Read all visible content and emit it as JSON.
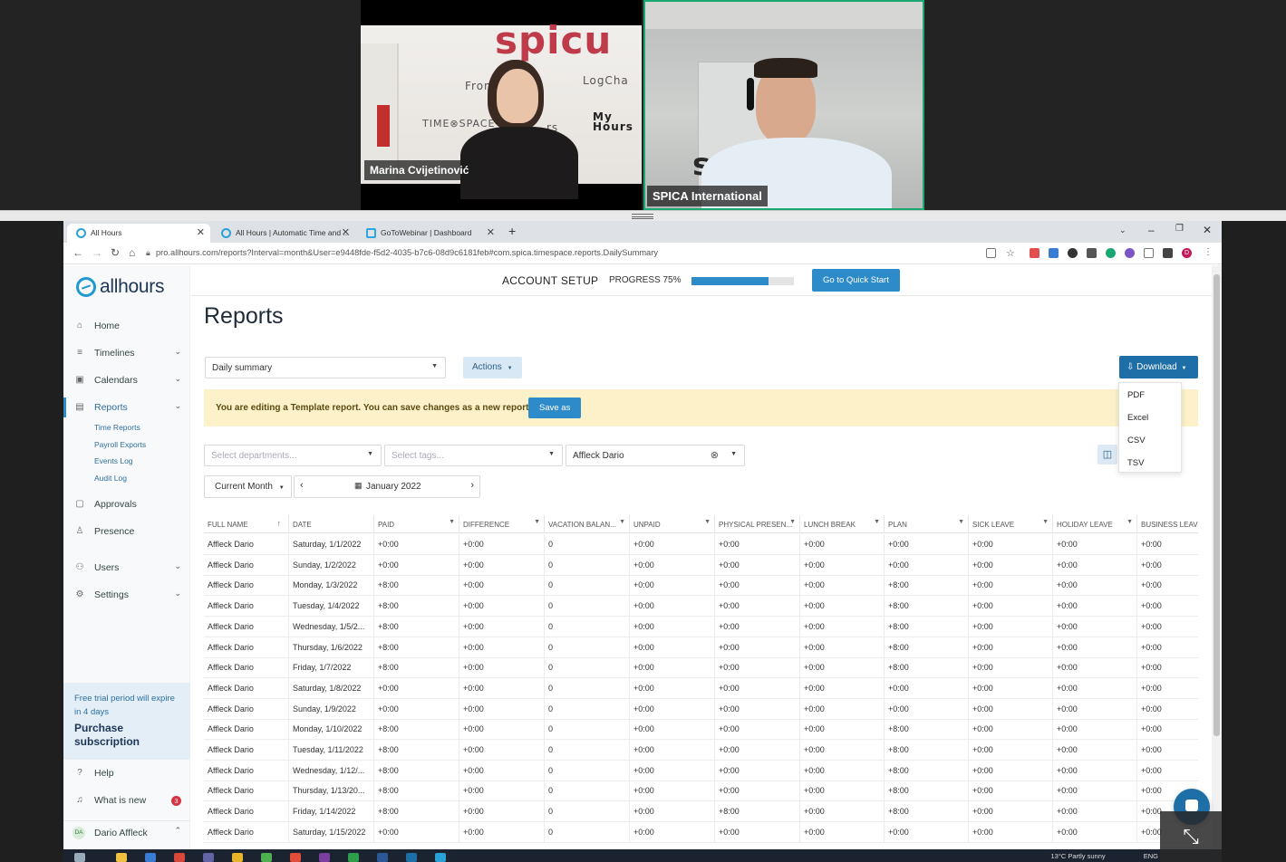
{
  "video": {
    "participant_1": {
      "name": "Marina Cvijetinović",
      "wall_brand": "spicu",
      "wall_logos": [
        "Frontm",
        "LogCha",
        "TIME⊗SPACE",
        "rs",
        "My Hours"
      ]
    },
    "participant_2": {
      "name": "SPICA International",
      "wall_brand": "sp"
    }
  },
  "browser": {
    "tabs": [
      {
        "title": "All Hours",
        "active": true
      },
      {
        "title": "All Hours | Automatic Time and ...",
        "active": false
      },
      {
        "title": "GoToWebinar | Dashboard",
        "active": false
      }
    ],
    "url": "pro.allhours.com/reports?Interval=month&User=e9448fde-f5d2-4035-b7c6-08d9c6181feb#com.spica.timespace.reports.DailySummary",
    "profile_initial": "D"
  },
  "sidebar": {
    "logo_text": "allhours",
    "items": [
      {
        "label": "Home",
        "icon": "home-icon"
      },
      {
        "label": "Timelines",
        "icon": "timelines-icon"
      },
      {
        "label": "Calendars",
        "icon": "calendar-icon"
      },
      {
        "label": "Reports",
        "icon": "reports-icon"
      },
      {
        "label": "Approvals",
        "icon": "approvals-icon"
      },
      {
        "label": "Presence",
        "icon": "presence-icon"
      },
      {
        "label": "Users",
        "icon": "users-icon"
      },
      {
        "label": "Settings",
        "icon": "gear-icon"
      }
    ],
    "report_subitems": [
      "Time Reports",
      "Payroll Exports",
      "Events Log",
      "Audit Log"
    ],
    "trial_text": "Free trial period will expire in 4 days",
    "trial_cta": "Purchase subscription",
    "help": "Help",
    "whats_new": "What is new",
    "whats_new_count": "3",
    "user_name": "Dario Affleck",
    "user_initials": "DA"
  },
  "setup": {
    "title": "ACCOUNT SETUP",
    "progress_label": "PROGRESS 75%",
    "progress_fraction": 0.75,
    "quick_start": "Go to Quick Start"
  },
  "main": {
    "page_title": "Reports",
    "report_type": "Daily summary",
    "actions_label": "Actions",
    "download_label": "Download",
    "download_options": [
      "PDF",
      "Excel",
      "CSV",
      "TSV"
    ],
    "banner_text": "You are editing a Template report. You can save changes as a new report.",
    "save_as": "Save as",
    "departments_placeholder": "Select departments...",
    "tags_placeholder": "Select tags...",
    "user_filter": "Affleck Dario",
    "period": "Current Month",
    "date_label": "January 2022"
  },
  "table": {
    "columns": [
      "FULL NAME",
      "DATE",
      "PAID",
      "DIFFERENCE",
      "VACATION BALAN...",
      "UNPAID",
      "PHYSICAL PRESEN...",
      "LUNCH BREAK",
      "PLAN",
      "SICK LEAVE",
      "HOLIDAY LEAVE",
      "BUSINESS LEAVE"
    ],
    "rows": [
      [
        "Affleck Dario",
        "Saturday, 1/1/2022",
        "+0:00",
        "+0:00",
        "0",
        "+0:00",
        "+0:00",
        "+0:00",
        "+0:00",
        "+0:00",
        "+0:00",
        "+0:00"
      ],
      [
        "Affleck Dario",
        "Sunday, 1/2/2022",
        "+0:00",
        "+0:00",
        "0",
        "+0:00",
        "+0:00",
        "+0:00",
        "+0:00",
        "+0:00",
        "+0:00",
        "+0:00"
      ],
      [
        "Affleck Dario",
        "Monday, 1/3/2022",
        "+8:00",
        "+0:00",
        "0",
        "+0:00",
        "+0:00",
        "+0:00",
        "+8:00",
        "+0:00",
        "+0:00",
        "+0:00"
      ],
      [
        "Affleck Dario",
        "Tuesday, 1/4/2022",
        "+8:00",
        "+0:00",
        "0",
        "+0:00",
        "+0:00",
        "+0:00",
        "+8:00",
        "+0:00",
        "+0:00",
        "+0:00"
      ],
      [
        "Affleck Dario",
        "Wednesday, 1/5/2...",
        "+8:00",
        "+0:00",
        "0",
        "+0:00",
        "+0:00",
        "+0:00",
        "+8:00",
        "+0:00",
        "+0:00",
        "+0:00"
      ],
      [
        "Affleck Dario",
        "Thursday, 1/6/2022",
        "+8:00",
        "+0:00",
        "0",
        "+0:00",
        "+0:00",
        "+0:00",
        "+8:00",
        "+0:00",
        "+0:00",
        "+0:00"
      ],
      [
        "Affleck Dario",
        "Friday, 1/7/2022",
        "+8:00",
        "+0:00",
        "0",
        "+0:00",
        "+0:00",
        "+0:00",
        "+8:00",
        "+0:00",
        "+0:00",
        "+0:00"
      ],
      [
        "Affleck Dario",
        "Saturday, 1/8/2022",
        "+0:00",
        "+0:00",
        "0",
        "+0:00",
        "+0:00",
        "+0:00",
        "+0:00",
        "+0:00",
        "+0:00",
        "+0:00"
      ],
      [
        "Affleck Dario",
        "Sunday, 1/9/2022",
        "+0:00",
        "+0:00",
        "0",
        "+0:00",
        "+0:00",
        "+0:00",
        "+0:00",
        "+0:00",
        "+0:00",
        "+0:00"
      ],
      [
        "Affleck Dario",
        "Monday, 1/10/2022",
        "+8:00",
        "+0:00",
        "0",
        "+0:00",
        "+0:00",
        "+0:00",
        "+8:00",
        "+0:00",
        "+0:00",
        "+0:00"
      ],
      [
        "Affleck Dario",
        "Tuesday, 1/11/2022",
        "+8:00",
        "+0:00",
        "0",
        "+0:00",
        "+0:00",
        "+0:00",
        "+8:00",
        "+0:00",
        "+0:00",
        "+0:00"
      ],
      [
        "Affleck Dario",
        "Wednesday, 1/12/...",
        "+8:00",
        "+0:00",
        "0",
        "+0:00",
        "+0:00",
        "+0:00",
        "+8:00",
        "+0:00",
        "+0:00",
        "+0:00"
      ],
      [
        "Affleck Dario",
        "Thursday, 1/13/20...",
        "+8:00",
        "+0:00",
        "0",
        "+0:00",
        "+0:00",
        "+0:00",
        "+8:00",
        "+0:00",
        "+0:00",
        "+0:00"
      ],
      [
        "Affleck Dario",
        "Friday, 1/14/2022",
        "+8:00",
        "+0:00",
        "0",
        "+0:00",
        "+8:00",
        "+0:00",
        "+8:00",
        "+0:00",
        "+0:00",
        "+0:00"
      ],
      [
        "Affleck Dario",
        "Saturday, 1/15/2022",
        "+0:00",
        "+0:00",
        "0",
        "+0:00",
        "+0:00",
        "+0:00",
        "+0:00",
        "+0:00",
        "+0:00",
        "+0:00"
      ]
    ]
  },
  "taskbar": {
    "weather": "13°C  Partly sunny",
    "language": "ENG"
  },
  "colors": {
    "accent": "#2d8bc9",
    "download_button": "#1e6fa8",
    "banner_bg": "#fcf1c8",
    "active_speaker_border": "#1aa772"
  }
}
